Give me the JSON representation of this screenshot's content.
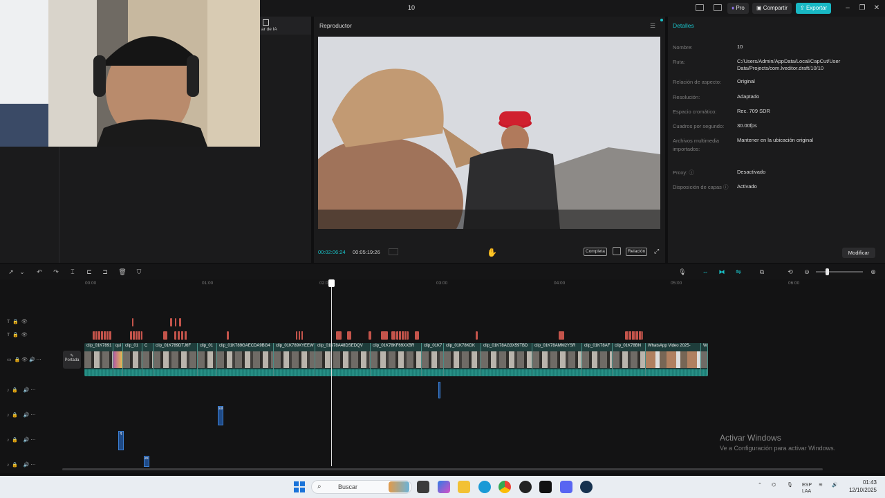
{
  "window": {
    "title": "10"
  },
  "header": {
    "pro_label": "Pro",
    "share_label": "Compartir",
    "export_label": "Exportar"
  },
  "left_panel": {
    "ai_tab_label": "ar de IA"
  },
  "player": {
    "title": "Reproductor",
    "current_time": "00:02:06:24",
    "total_time": "00:05:19:26",
    "full_label": "Completa",
    "ratio_label": "Relación"
  },
  "details": {
    "title": "Detalles",
    "rows": [
      {
        "label": "Nombre:",
        "value": "10"
      },
      {
        "label": "Ruta:",
        "value": "C:/Users/Admin/AppData/Local/CapCut/User Data/Projects/com.lveditor.draft/10/10"
      },
      {
        "label": "Relación de aspecto:",
        "value": "Original"
      },
      {
        "label": "Resolución:",
        "value": "Adaptado"
      },
      {
        "label": "Espacio cromático:",
        "value": "Rec. 709 SDR"
      },
      {
        "label": "Cuadros por segundo:",
        "value": "30.00fps"
      },
      {
        "label": "Archivos multimedia importados:",
        "value": "Mantener en la ubicación original"
      },
      {
        "label": "Proxy: ⓘ",
        "value": "Desactivado"
      },
      {
        "label": "Disposición de capas ⓘ",
        "value": "Activado"
      }
    ],
    "modify_label": "Modificar"
  },
  "timeline": {
    "ticks": [
      "00:00",
      "01:00",
      "02:00",
      "03:00",
      "04:00",
      "05:00",
      "06:00"
    ],
    "cover_label": "Portada",
    "clips": [
      {
        "name": "clip_01K7891"
      },
      {
        "name": "qui"
      },
      {
        "name": "clip_01"
      },
      {
        "name": "C"
      },
      {
        "name": "clip_01K789DTJ6F"
      },
      {
        "name": "clip_01"
      },
      {
        "name": "clip_01K789GAECDA9BG4"
      },
      {
        "name": "clip_01K789XYEEW"
      },
      {
        "name": "clip_01K78A48DSEDQV"
      },
      {
        "name": "clip_01K78KF69XXBR"
      },
      {
        "name": "clip_01K7"
      },
      {
        "name": "clip_01K78KDK"
      },
      {
        "name": "clip_01K78AG3X59TBD"
      },
      {
        "name": "clip_01K78AMM2YSR"
      },
      {
        "name": "clip_01K78AF"
      },
      {
        "name": "clip_01K78BN"
      },
      {
        "name": "WhatsApp Video 2025-"
      },
      {
        "name": "W"
      }
    ],
    "audio_labels": [
      "sol",
      "q",
      "es"
    ]
  },
  "watermark": {
    "line1": "Activar Windows",
    "line2": "Ve a Configuración para activar Windows."
  },
  "taskbar": {
    "search_placeholder": "Buscar",
    "lang": "ESP",
    "lang2": "LAA",
    "time": "01:43",
    "date": "12/10/2025"
  },
  "colors": {
    "accent": "#19c3c9",
    "export_bg": "#19b8c4",
    "marker": "#c4544b",
    "clip_bg": "#1e3d3b"
  }
}
